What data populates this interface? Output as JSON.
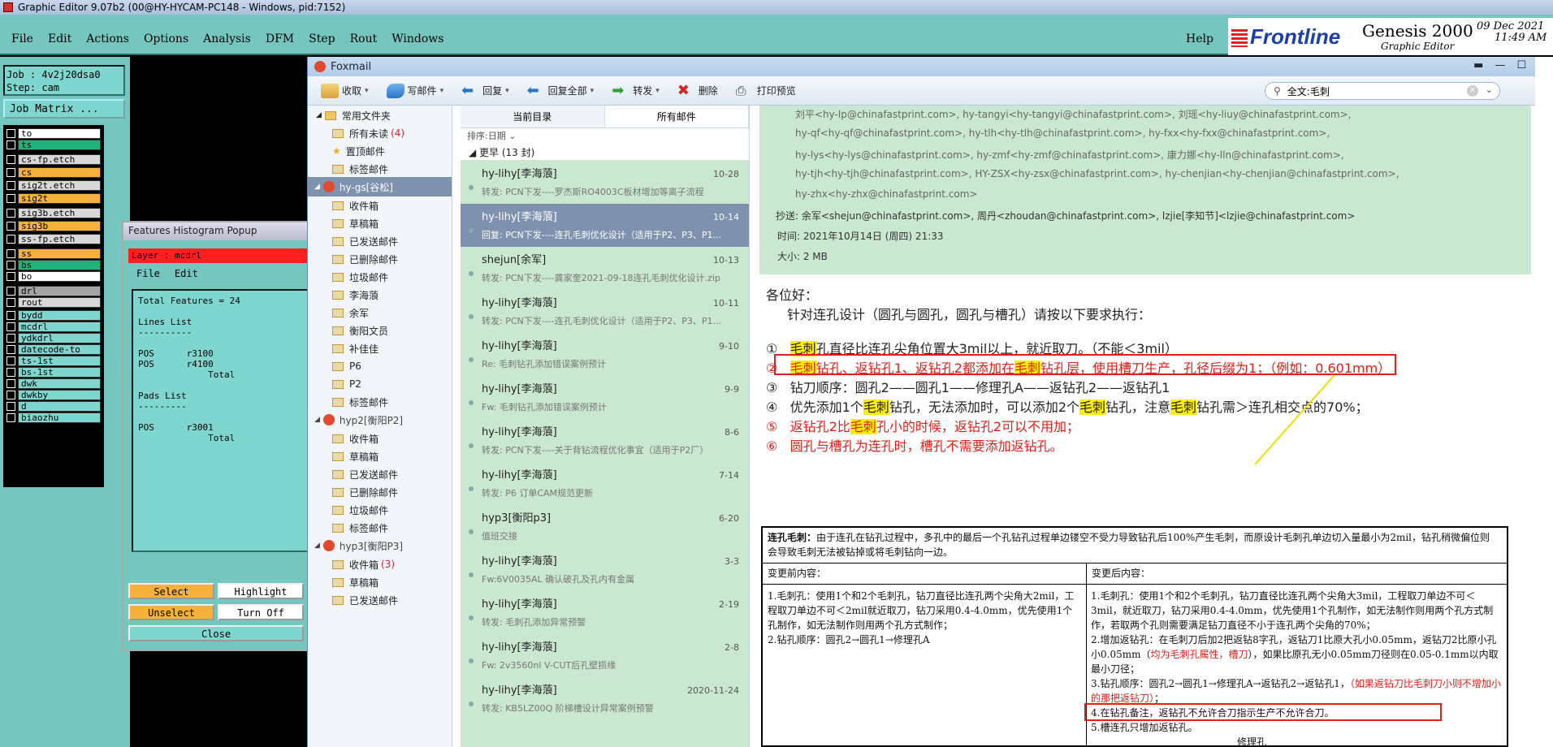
{
  "genesis": {
    "window_title": "Graphic Editor 9.07b2 (00@HY-HYCAM-PC148 - Windows, pid:7152)",
    "menu": [
      "File",
      "Edit",
      "Actions",
      "Options",
      "Analysis",
      "DFM",
      "Step",
      "Rout",
      "Windows"
    ],
    "help": "Help",
    "brand_logo": "Frontline",
    "product": "Genesis 2000",
    "product_sub": "Graphic Editor",
    "date": "09 Dec 2021",
    "time": "11:49 AM",
    "job": "Job : 4v2j20dsa0",
    "step": "Step: cam",
    "job_matrix": "Job Matrix ...",
    "layers": [
      {
        "name": "to",
        "color": "#ffffff"
      },
      {
        "name": "ts",
        "color": "#1fb27a"
      },
      {
        "name": "cs-fp.etch",
        "color": "#d8d8d8"
      },
      {
        "name": "cs",
        "color": "#f5b13c"
      },
      {
        "name": "sig2t.etch",
        "color": "#d8d8d8"
      },
      {
        "name": "sig2t",
        "color": "#f5b13c"
      },
      {
        "name": "sig3b.etch",
        "color": "#d8d8d8"
      },
      {
        "name": "sig3b",
        "color": "#f5b13c"
      },
      {
        "name": "ss-fp.etch",
        "color": "#d8d8d8"
      },
      {
        "name": "ss",
        "color": "#f5b13c"
      },
      {
        "name": "bs",
        "color": "#1fb27a"
      },
      {
        "name": "bo",
        "color": "#ffffff"
      },
      {
        "name": "drl",
        "color": "#a5a5a5"
      },
      {
        "name": "rout",
        "color": "#d8d8d8"
      },
      {
        "name": "bydd",
        "color": "#7fd6ce"
      },
      {
        "name": "mcdrl",
        "color": "#7fd6ce"
      },
      {
        "name": "ydkdrl",
        "color": "#7fd6ce"
      },
      {
        "name": "datecode-to",
        "color": "#7fd6ce"
      },
      {
        "name": "ts-1st",
        "color": "#7fd6ce"
      },
      {
        "name": "bs-1st",
        "color": "#7fd6ce"
      },
      {
        "name": "dwk",
        "color": "#7fd6ce"
      },
      {
        "name": "dwkby",
        "color": "#7fd6ce"
      },
      {
        "name": "d",
        "color": "#7fd6ce"
      },
      {
        "name": "biaozhu",
        "color": "#7fd6ce"
      }
    ]
  },
  "histogram": {
    "title": "Features Histogram Popup",
    "layer": "Layer : mcdrl",
    "menu_file": "File",
    "menu_edit": "Edit",
    "content": "Total Features = 24\n\nLines List\n----------\n\nPOS      r3100\nPOS      r4100\n             Total\n\nPads List\n---------\n\nPOS      r3001\n             Total",
    "btn_select": "Select",
    "btn_highlight": "Highlight",
    "btn_unselect": "Unselect",
    "btn_turnoff": "Turn Off",
    "btn_close": "Close"
  },
  "foxmail": {
    "title": "Foxmail",
    "toolbar": [
      "收取",
      "写邮件",
      "回复",
      "回复全部",
      "转发",
      "删除",
      "打印预览"
    ],
    "search_value": "全文:毛刺",
    "folders": {
      "common": "常用文件夹",
      "unread": "所有未读",
      "unread_count": "(4)",
      "starred": "置顶邮件",
      "tagged": "标签邮件",
      "account1": "hy-gs[谷松]",
      "account1_folders": [
        "收件箱",
        "草稿箱",
        "已发送邮件",
        "已删除邮件",
        "垃圾邮件",
        "李海蒗",
        "余军",
        "衡阳文员",
        "补佳佳",
        "P6",
        "P2",
        "标签邮件"
      ],
      "account2": "hyp2[衡阳P2]",
      "account2_folders": [
        "收件箱",
        "草稿箱",
        "已发送邮件",
        "已删除邮件",
        "垃圾邮件",
        "标签邮件"
      ],
      "account3": "hyp3[衡阳P3]",
      "account3_folders": [
        "收件箱",
        "草稿箱",
        "已发送邮件"
      ],
      "account3_inbox_count": "(3)"
    },
    "list": {
      "tab_current": "当前目录",
      "tab_all": "所有邮件",
      "sort": "排序:日期",
      "group": "更早 (13 封)",
      "items": [
        {
          "from": "hy-lihy[李海蒗]",
          "date": "10-28",
          "subj": "转发: PCN下发----罗杰斯RO4003C板材增加等离子流程"
        },
        {
          "from": "hy-lihy[李海蒗]",
          "date": "10-14",
          "subj": "回复: PCN下发----连孔毛刺优化设计（适用于P2、P3、P1..."
        },
        {
          "from": "shejun[余军]",
          "date": "10-13",
          "subj": "转发: PCN下发----龚家奎2021-09-18连孔毛刺优化设计.zip"
        },
        {
          "from": "hy-lihy[李海蒗]",
          "date": "10-11",
          "subj": "转发: PCN下发----连孔毛刺优化设计（适用于P2、P3、P1..."
        },
        {
          "from": "hy-lihy[李海蒗]",
          "date": "9-10",
          "subj": "Re: 毛刺钻孔添加错误案例预计"
        },
        {
          "from": "hy-lihy[李海蒗]",
          "date": "9-9",
          "subj": "Fw: 毛刺钻孔添加错误案例预计"
        },
        {
          "from": "hy-lihy[李海蒗]",
          "date": "8-6",
          "subj": "转发: PCN下发----关于背钻流程优化事宜（适用于P2厂）"
        },
        {
          "from": "hy-lihy[李海蒗]",
          "date": "7-14",
          "subj": "转发: P6 订单CAM规范更新"
        },
        {
          "from": "hyp3[衡阳p3]",
          "date": "6-20",
          "subj": "值班交接"
        },
        {
          "from": "hy-lihy[李海蒗]",
          "date": "3-3",
          "subj": "Fw:6V0035AL 确认破孔及孔内有金属"
        },
        {
          "from": "hy-lihy[李海蒗]",
          "date": "2-19",
          "subj": "转发: 毛刺孔添加异常预警"
        },
        {
          "from": "hy-lihy[李海蒗]",
          "date": "2-8",
          "subj": "Fw: 2v3560nl V-CUT后孔壁损缘"
        },
        {
          "from": "hy-lihy[李海蒗]",
          "date": "2020-11-24",
          "subj": "转发: KB5LZ00Q 阶梯槽设计异常案例预警"
        }
      ]
    },
    "header": {
      "to_line1": "刘平<hy-lp@chinafastprint.com>, hy-tangyi<hy-tangyi@chinafastprint.com>, 刘瑶<hy-liuy@chinafastprint.com>,",
      "to_line2": "hy-qf<hy-qf@chinafastprint.com>, hy-tlh<hy-tlh@chinafastprint.com>, hy-fxx<hy-fxx@chinafastprint.com>,",
      "to_line3": "hy-lys<hy-lys@chinafastprint.com>, hy-zmf<hy-zmf@chinafastprint.com>, 康力娜<hy-lln@chinafastprint.com>,",
      "to_line4": "hy-tjh<hy-tjh@chinafastprint.com>, HY-ZSX<hy-zsx@chinafastprint.com>, hy-chenjian<hy-chenjian@chinafastprint.com>,",
      "to_line5": "hy-zhx<hy-zhx@chinafastprint.com>",
      "cc": "抄送: 余军<shejun@chinafastprint.com>, 周丹<zhoudan@chinafastprint.com>, lzjie[李知节]<lzjie@chinafastprint.com>",
      "time": "时间: 2021年10月14日 (周四) 21:33",
      "size": "大小: 2 MB"
    },
    "body": {
      "greeting": "各位好：",
      "intro": "针对连孔设计（圆孔与圆孔，圆孔与槽孔）请按以下要求执行：",
      "l1_num": "①",
      "l1_a": "毛刺",
      "l1_b": "孔直径比连孔尖角位置大3mil以上，就近取刀。（不能＜3mil）",
      "l2_num": "②",
      "l2_a": "毛刺",
      "l2_b": "钻孔、返钻孔1、返钻孔2都添加在",
      "l2_c": "毛刺",
      "l2_d": "钻孔层，使用槽刀生产，孔径后缀为1；（例如：0.601mm）",
      "l3_num": "③",
      "l3": "钻刀顺序：圆孔2——圆孔1——修理孔A——返钻孔2——返钻孔1",
      "l4_num": "④",
      "l4_a": "优先添加1个",
      "l4_b": "毛刺",
      "l4_c": "钻孔，无法添加时，可以添加2个",
      "l4_d": "毛刺",
      "l4_e": "钻孔，注意",
      "l4_f": "毛刺",
      "l4_g": "钻孔需＞连孔相交点的70%；",
      "l5_num": "⑤",
      "l5_a": "返钻孔2比",
      "l5_b": "毛刺",
      "l5_c": "孔小的时候，返钻孔2可以不用加；",
      "l6_num": "⑥",
      "l6": "圆孔与槽孔为连孔时，槽孔不需要添加返钻孔。"
    },
    "doc": {
      "head_bold": "连孔毛刺：",
      "head": "由于连孔在钻孔过程中，多孔中的最后一个孔钻孔过程单边镂空不受力导致钻孔后100%产生毛刺，而原设计毛刺孔单边切入量最小为2mil，钻孔稍微偏位则会导致毛刺无法被钻掉或将毛刺钻向一边。",
      "before_title": "变更前内容：",
      "after_title": "变更后内容：",
      "before": "1.毛刺孔：使用1个和2个毛刺孔，钻刀直径比连孔两个尖角大2mil，工程取刀单边不可＜2mil就近取刀，钻刀采用0.4-4.0mm，优先使用1个孔制作，如无法制作则用两个孔方式制作；\n2.钻孔顺序：圆孔2→圆孔1→修理孔A",
      "after1": "1.毛刺孔：使用1个和2个毛刺孔，钻刀直径比连孔两个尖角大3mil，工程取刀单边不可＜3mil，就近取刀，钻刀采用0.4-4.0mm，优先使用1个孔制作，如无法制作则用两个孔方式制作，若取两个孔则需要满足钻刀直径不小于连孔两个尖角的70%；",
      "after2": "2.增加返钻孔：在毛刺刀后加2把返钻8字孔，返钻刀1比原大孔小0.05mm，返钻刀2比原小孔小0.05mm（",
      "after2_red": "均为毛刺孔属性，槽刀",
      "after2_end": "），如果比原孔无小0.05mm刀径则在0.05-0.1mm以内取最小刀径；",
      "after3": "3.钻孔顺序：圆孔2→圆孔1→修理孔A→返钻孔2→返钻孔1，",
      "after3_red": "（如果返钻刀比毛刺刀小则不增加小的那把返钻刀）",
      "after3_end": "；",
      "after4": "4.在钻孔备注，返钻孔不允许合刀指示生产不允许合刀。",
      "after5": "5.槽连孔只增加返钻孔。",
      "bottom": "修理孔"
    }
  }
}
